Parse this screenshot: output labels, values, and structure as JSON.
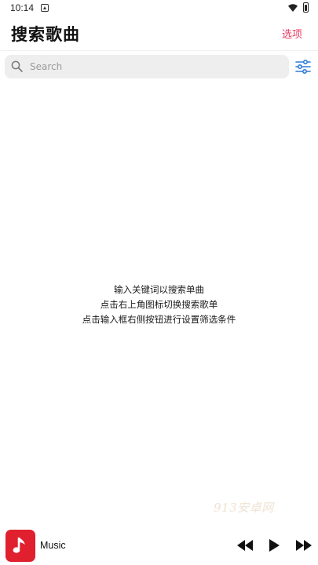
{
  "status_bar": {
    "time": "10:14"
  },
  "header": {
    "title": "搜索歌曲",
    "options_label": "选项"
  },
  "search": {
    "placeholder": "Search",
    "value": ""
  },
  "empty_state": {
    "lines": [
      "输入关键词以搜索单曲",
      "点击右上角图标切换搜索歌单",
      "点击输入框右侧按钮进行设置筛选条件"
    ]
  },
  "watermark": "913安卓网",
  "player": {
    "track_title": "Music"
  },
  "colors": {
    "accent": "#e53960",
    "album_art": "#e0202f",
    "filter_icon": "#2e7bd6"
  },
  "icons": [
    "notification-icon",
    "wifi-icon",
    "battery-icon",
    "search-icon",
    "filter-icon",
    "music-note-icon",
    "previous-icon",
    "play-icon",
    "next-icon"
  ]
}
